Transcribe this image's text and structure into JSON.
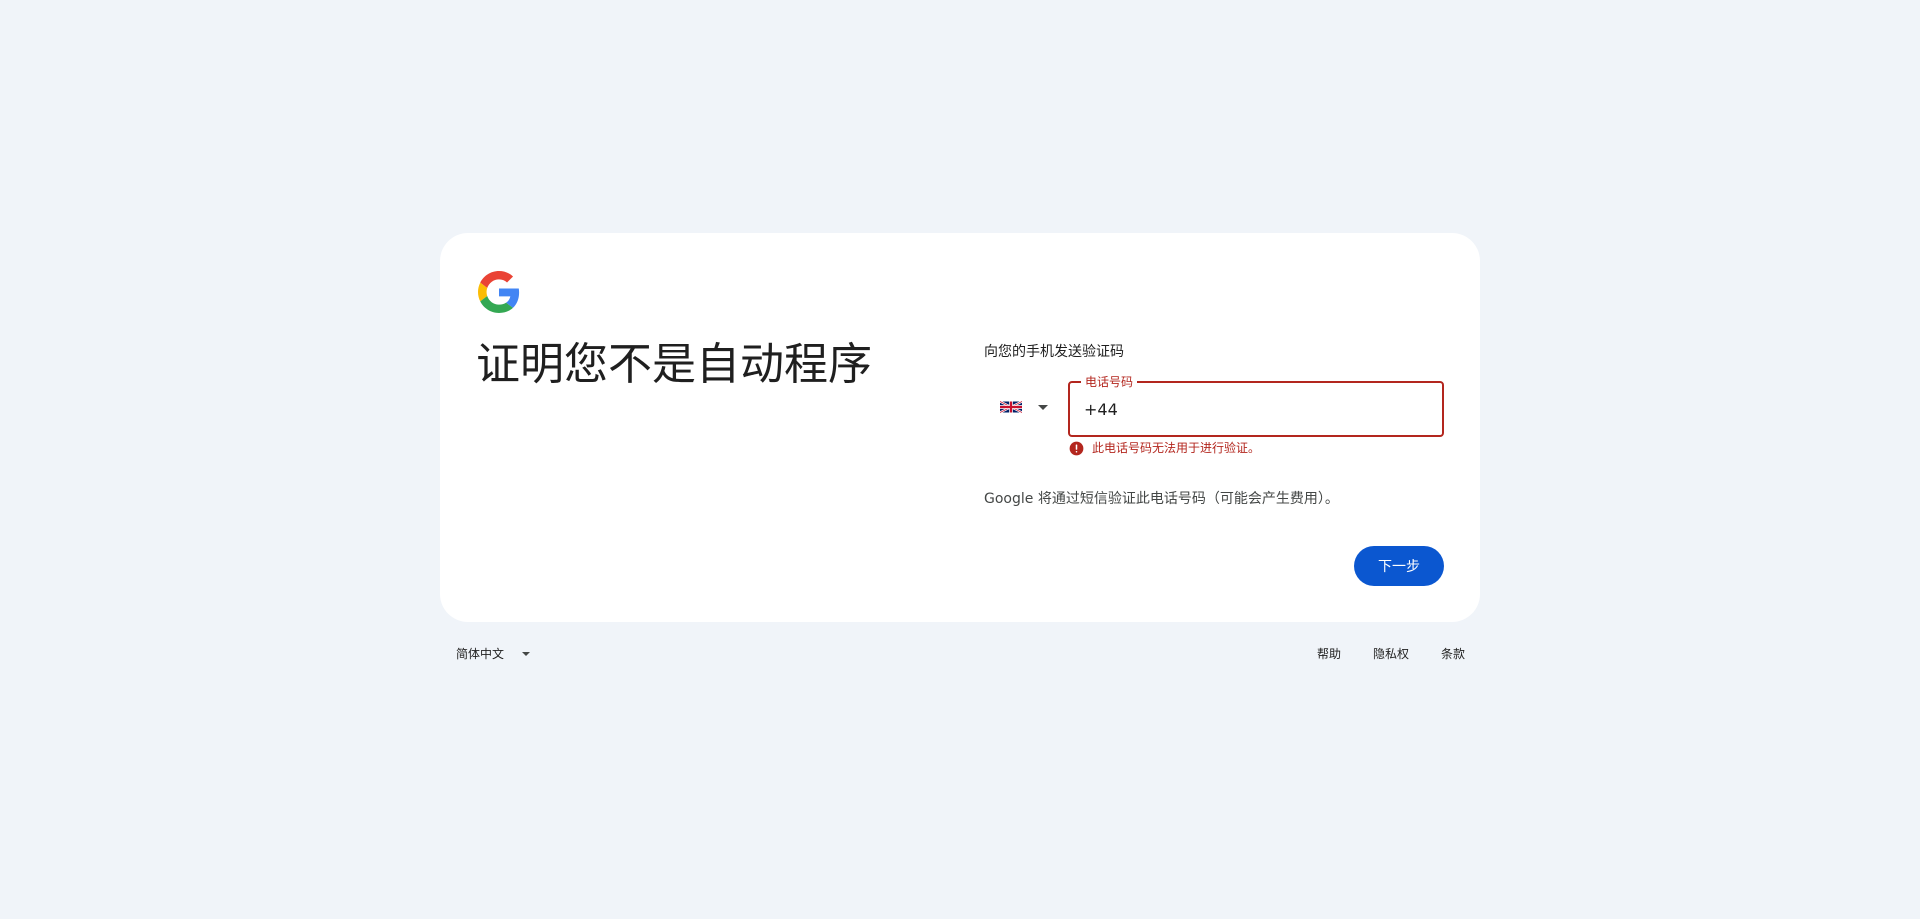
{
  "card": {
    "title": "证明您不是自动程序",
    "subtitle": "向您的手机发送验证码",
    "country": {
      "flag_icon": "uk-flag-icon",
      "dropdown_icon": "chevron-down-icon"
    },
    "phone": {
      "label": "电话号码",
      "value": "+44"
    },
    "error": {
      "icon": "error-icon",
      "message": "此电话号码无法用于进行验证。"
    },
    "sms_note": "Google 将通过短信验证此电话号码（可能会产生费用）。",
    "next_label": "下一步"
  },
  "footer": {
    "language": "简体中文",
    "links": {
      "help": "帮助",
      "privacy": "隐私权",
      "terms": "条款"
    }
  },
  "colors": {
    "background": "#f0f4f9",
    "card": "#ffffff",
    "primary": "#0b57d0",
    "error": "#b3261e",
    "text": "#1f1f1f",
    "secondary_text": "#444746"
  }
}
